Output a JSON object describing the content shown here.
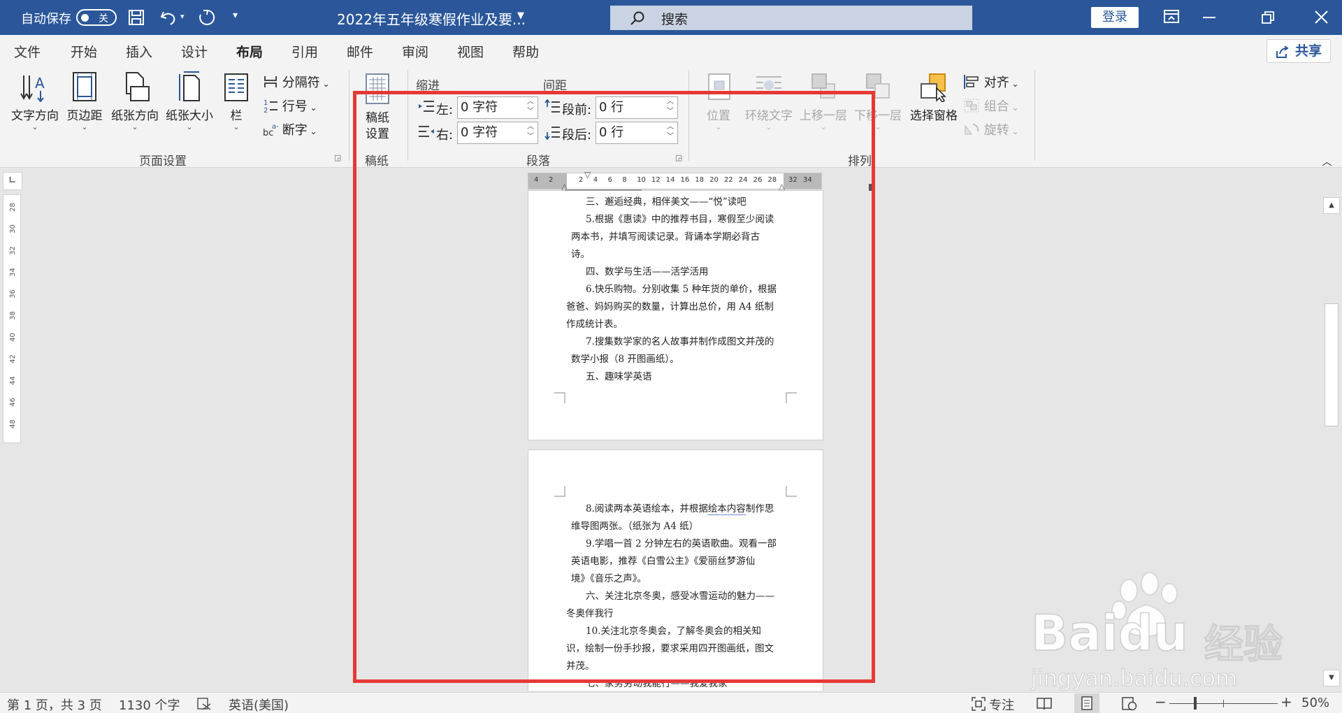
{
  "titlebar": {
    "autosave_label": "自动保存",
    "autosave_state": "关",
    "doc_title": "2022年五年级寒假作业及要...",
    "search_placeholder": "搜索",
    "login_label": "登录",
    "bg_color": "#2b579a"
  },
  "menu": {
    "items": [
      "文件",
      "开始",
      "插入",
      "设计",
      "布局",
      "引用",
      "邮件",
      "审阅",
      "视图",
      "帮助"
    ],
    "active": "布局",
    "share_label": "共享"
  },
  "ribbon": {
    "page_setup": {
      "text_direction": "文字方向",
      "margins": "页边距",
      "orientation": "纸张方向",
      "size": "纸张大小",
      "columns": "栏",
      "breaks": "分隔符",
      "line_numbers": "行号",
      "hyphenation": "断字",
      "group_label": "页面设置"
    },
    "draft": {
      "button_line1": "稿纸",
      "button_line2": "设置",
      "group_label": "稿纸"
    },
    "paragraph": {
      "indent_header": "缩进",
      "spacing_header": "间距",
      "left_label": "左:",
      "left_value": "0 字符",
      "right_label": "右:",
      "right_value": "0 字符",
      "before_label": "段前:",
      "before_value": "0 行",
      "after_label": "段后:",
      "after_value": "0 行",
      "group_label": "段落"
    },
    "arrange": {
      "position": "位置",
      "wrap_text": "环绕文字",
      "bring_forward": "上移一层",
      "send_backward": "下移一层",
      "selection_pane": "选择窗格",
      "align": "对齐",
      "group": "组合",
      "rotate": "旋转",
      "group_label": "排列"
    }
  },
  "rulers": {
    "vertical_ticks": [
      "28",
      "30",
      "32",
      "34",
      "36",
      "38",
      "40",
      "42",
      "44",
      "46",
      "48"
    ],
    "horizontal_left": [
      "4",
      "2"
    ],
    "horizontal_ticks": [
      "2",
      "4",
      "6",
      "8",
      "10",
      "12",
      "14",
      "16",
      "18",
      "20",
      "22",
      "24",
      "26",
      "28"
    ],
    "horizontal_right": [
      "32",
      "34"
    ]
  },
  "page1_lines": [
    "三、邂逅经典，相伴美文——“悦”读吧",
    "5.根据《惠读》中的推荐书目，寒假至少阅读",
    "两本书，并填写阅读记录。背诵本学期必背古",
    "诗。",
    "四、数学与生活——活学活用",
    "6.快乐购物。分别收集 5 种年货的单价，根据",
    "爸爸、妈妈购买的数量，计算出总价，用 A4 纸制",
    "作成统计表。",
    "7.搜集数学家的名人故事并制作成图文并茂的",
    "数学小报（8 开图画纸）。",
    "五、趣味学英语"
  ],
  "page2_lines": [
    "8.阅读两本英语绘本，并根据绘本内容制作思",
    "维导图两张。（纸张为 A4 纸）",
    "9.学唱一首 2 分钟左右的英语歌曲。观看一部",
    "英语电影，推荐《白雪公主》《爱丽丝梦游仙",
    "境》《音乐之声》。",
    "六、关注北京冬奥，感受冰雪运动的魅力——",
    "冬奥伴我行",
    "10.关注北京冬奥会，了解冬奥会的相关知",
    "识，绘制一份手抄报，要求采用四开图画纸，图文",
    "并茂。",
    "七、家务劳动我能行——我爱我家"
  ],
  "statusbar": {
    "page_info": "第 1 页，共 3 页",
    "word_count": "1130 个字",
    "language": "英语(美国)",
    "focus": "专注",
    "zoom_minus": "−",
    "zoom_plus": "+",
    "zoom_level": "50%"
  },
  "watermark": {
    "brand": "Baidu",
    "brand_cn": "经验",
    "url": "jingyan.baidu.com"
  },
  "highlight_color": "#e53935"
}
